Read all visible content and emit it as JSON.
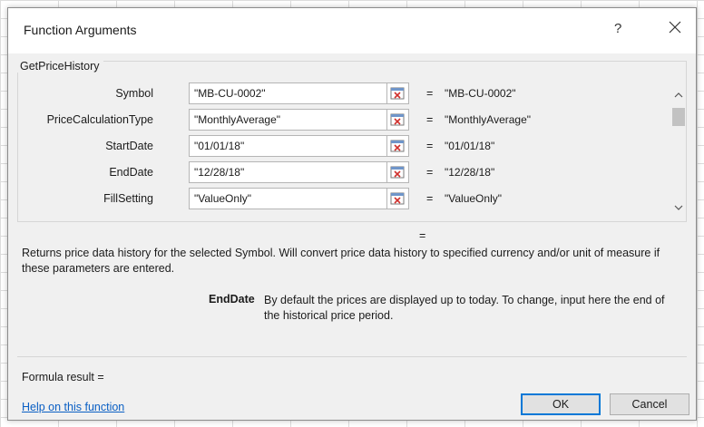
{
  "dialog": {
    "title": "Function Arguments",
    "help_glyph": "?",
    "close_glyph": "✕"
  },
  "function": {
    "name": "GetPriceHistory",
    "arguments": [
      {
        "label": "Symbol",
        "input": "\"MB-CU-0002\"",
        "value": "\"MB-CU-0002\""
      },
      {
        "label": "PriceCalculationType",
        "input": "\"MonthlyAverage\"",
        "value": "\"MonthlyAverage\""
      },
      {
        "label": "StartDate",
        "input": "\"01/01/18\"",
        "value": "\"01/01/18\""
      },
      {
        "label": "EndDate",
        "input": "\"12/28/18\"",
        "value": "\"12/28/18\""
      },
      {
        "label": "FillSetting",
        "input": "\"ValueOnly\"",
        "value": "\"ValueOnly\""
      }
    ],
    "equals": "=",
    "result_equals": "=",
    "description": "Returns price data history for the selected Symbol. Will convert price data history to specified currency and/or unit of measure if these parameters are entered.",
    "param_name": "EndDate",
    "param_description": "By default the prices are displayed up to today. To change, input here the end of the historical price period."
  },
  "footer": {
    "formula_result_label": "Formula result =",
    "help_link": "Help on this function",
    "ok_label": "OK",
    "cancel_label": "Cancel"
  },
  "colors": {
    "link": "#0a5fc4",
    "ok_border": "#0078d7"
  },
  "icons": {
    "collapse": "collapse-dialog-icon",
    "scroll_up": "chevron-up-icon",
    "scroll_down": "chevron-down-icon"
  }
}
